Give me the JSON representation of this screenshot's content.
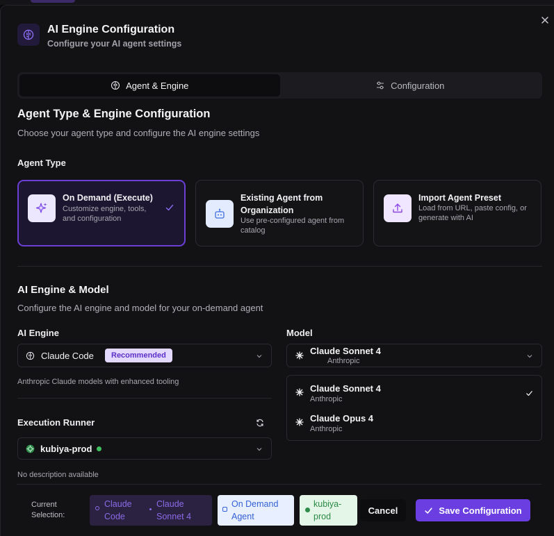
{
  "dialog": {
    "title": "AI Engine Configuration",
    "subtitle": "Configure your AI agent settings",
    "icon": "brain-icon",
    "close_icon": "close-icon"
  },
  "tabs": [
    {
      "label": "Agent & Engine",
      "icon": "brain-icon",
      "active": true
    },
    {
      "label": "Configuration",
      "icon": "sliders-icon",
      "active": false
    }
  ],
  "agent_section": {
    "title": "Agent Type & Engine Configuration",
    "description": "Choose your agent type and configure the AI engine settings",
    "label": "Agent Type",
    "cards": [
      {
        "title": "On Demand (Execute)",
        "description": "Customize engine, tools, and configuration",
        "icon": "sparkles-icon",
        "selected": true
      },
      {
        "title": "Existing Agent from Organization",
        "description": "Use pre-configured agent from catalog",
        "icon": "robot-icon",
        "selected": false
      },
      {
        "title": "Import Agent Preset",
        "description": "Load from URL, paste config, or generate with AI",
        "icon": "upload-icon",
        "selected": false
      }
    ]
  },
  "engine_section": {
    "title": "AI Engine & Model",
    "description": "Configure the AI engine and model for your on-demand agent",
    "engine_label": "AI Engine",
    "engine_value": "Claude Code",
    "engine_badge": "Recommended",
    "engine_help": "Anthropic Claude models with enhanced tooling",
    "model_label": "Model",
    "model_value": "Claude Sonnet 4",
    "model_provider": "Anthropic",
    "model_options": [
      {
        "name": "Claude Sonnet 4",
        "provider": "Anthropic",
        "selected": true
      },
      {
        "name": "Claude Opus 4",
        "provider": "Anthropic",
        "selected": false
      }
    ]
  },
  "runner_section": {
    "label": "Execution Runner",
    "value": "kubiya-prod",
    "status": "online",
    "help": "No description available"
  },
  "footer": {
    "current_label": "Current Selection:",
    "engine_chip": [
      "Claude Code",
      "Claude Sonnet 4"
    ],
    "agent_chip": "On Demand Agent",
    "runner_chip": "kubiya-prod",
    "cancel_label": "Cancel",
    "save_label": "Save Configuration"
  },
  "colors": {
    "accent": "#6a3ee0",
    "status_online": "#3fbf5f",
    "badge_bg": "#e3d9ff"
  }
}
